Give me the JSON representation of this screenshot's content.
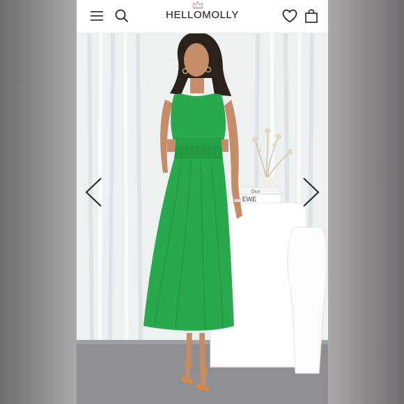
{
  "header": {
    "brand": "HELLOMOLLY",
    "menu_icon": "hamburger-menu-icon",
    "search_icon": "search-icon",
    "wishlist_icon": "heart-icon",
    "bag_icon": "shopping-bag-icon"
  },
  "gallery": {
    "prev_icon": "chevron-left-icon",
    "next_icon": "chevron-right-icon",
    "image_subject": "model in green sleeveless cut-out midi dress",
    "book_text_top": "Dior",
    "book_text_bottom": "EWE"
  },
  "colors": {
    "dress": "#2aa84f",
    "accent": "#111111",
    "crown": "#c9a6a0",
    "backdrop": "#eef1f2",
    "floor": "#8f8f93"
  }
}
